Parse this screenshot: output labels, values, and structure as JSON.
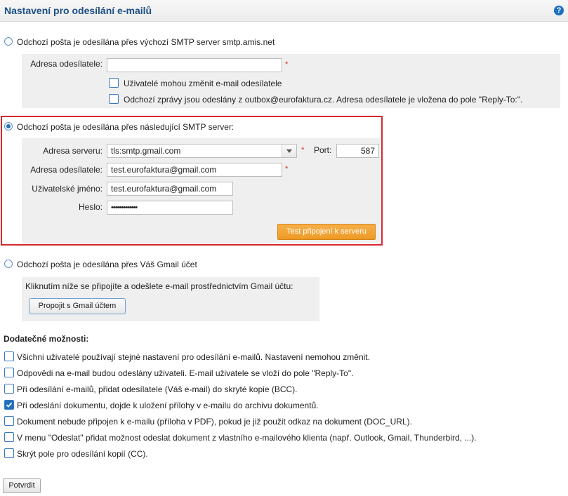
{
  "header": {
    "title": "Nastavení pro odesílání e-mailů",
    "help_icon": "?"
  },
  "option1": {
    "label": "Odchozí pošta je odesílána přes výchozí SMTP server smtp.amis.net",
    "sender_label": "Adresa odesílatele:",
    "sender_value": "",
    "required_mark": "*",
    "users_can_change": "Uživatelé mohou změnit e-mail odesílatele",
    "outbox_note": "Odchozí zprávy jsou odeslány z outbox@eurofaktura.cz. Adresa odesílatele je vložena do pole \"Reply-To:\"."
  },
  "option2": {
    "label": "Odchozí pošta je odesílána přes následující SMTP server:",
    "server_label": "Adresa serveru:",
    "server_value": "tls:smtp.gmail.com",
    "port_label": "Port:",
    "port_value": "587",
    "sender_label": "Adresa odesílatele:",
    "sender_value": "test.eurofaktura@gmail.com",
    "username_label": "Uživatelské jméno:",
    "username_value": "test.eurofaktura@gmail.com",
    "password_label": "Heslo:",
    "password_value": "•••••••••••••",
    "required_mark": "*",
    "test_button": "Test připojení k serveru"
  },
  "option3": {
    "label": "Odchozí pošta je odesílána přes Váš Gmail účet",
    "info": "Kliknutím níže se připojíte a odešlete e-mail prostřednictvím Gmail účtu:",
    "connect_button": "Propojit s Gmail účtem"
  },
  "additional": {
    "title": "Dodatečné možnosti:",
    "items": [
      {
        "label": "Všichni uživatelé používají stejné nastavení pro odesílání e-mailů. Nastavení nemohou změnit.",
        "checked": false
      },
      {
        "label": "Odpovědi na e-mail budou odeslány uživateli. E-mail uživatele se vloží do pole \"Reply-To\".",
        "checked": false
      },
      {
        "label": "Při odesílání e-mailů, přidat odesílatele (Váš e-mail) do skryté kopie (BCC).",
        "checked": false
      },
      {
        "label": "Při odeslání dokumentu, dojde k uložení přílohy v e-mailu do archivu dokumentů.",
        "checked": true
      },
      {
        "label": "Dokument nebude připojen k e-mailu (příloha v PDF), pokud je již použit odkaz na dokument (DOC_URL).",
        "checked": false
      },
      {
        "label": "V menu \"Odeslat\" přidat možnost odeslat dokument z vlastního e-mailového klienta (např. Outlook, Gmail, Thunderbird, ...).",
        "checked": false
      },
      {
        "label": "Skrýt pole pro odesílání kopií (CC).",
        "checked": false
      }
    ]
  },
  "submit_button": "Potvrdit",
  "colors": {
    "accent": "#1e6fbf",
    "title": "#1b4f87",
    "highlight": "#d9262e",
    "orange": "#ee9a24"
  }
}
